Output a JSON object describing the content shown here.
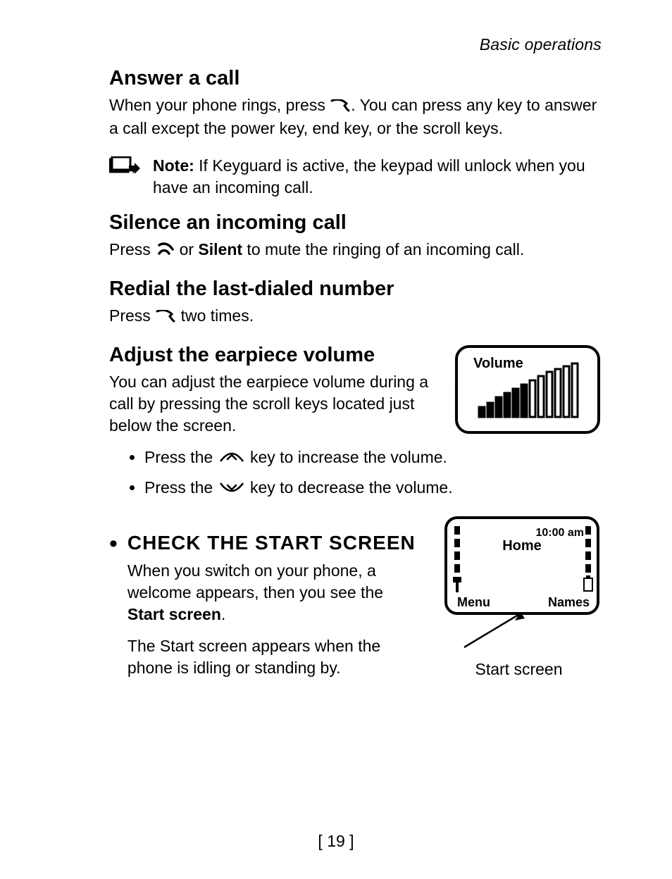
{
  "header": "Basic operations",
  "sections": {
    "answer": {
      "title": "Answer a call",
      "p1a": "When your phone rings, press ",
      "p1b": ". You can press any key to answer a call except the power key, end key, or the scroll keys.",
      "note_label": "Note:",
      "note_text": " If Keyguard is active, the keypad will unlock when you have an incoming call."
    },
    "silence": {
      "title": "Silence an incoming call",
      "p_a": "Press ",
      "p_b": " or ",
      "silent": "Silent",
      "p_c": " to mute the ringing of an incoming call."
    },
    "redial": {
      "title": "Redial the last-dialed number",
      "p_a": "Press ",
      "p_b": " two times."
    },
    "volume": {
      "title": "Adjust the earpiece volume",
      "p": "You can adjust the earpiece volume during a call by pressing the scroll keys located just below the screen.",
      "b1a": "Press the ",
      "b1b": " key to increase the volume.",
      "b2a": "Press the ",
      "b2b": " key to decrease the volume.",
      "screen_label": "Volume"
    },
    "start": {
      "title": "CHECK THE START SCREEN",
      "p1a": "When you switch on your phone, a welcome appears, then you see the ",
      "p1b": "Start screen",
      "p1c": ".",
      "p2": "The Start screen appears when the phone is idling or standing by.",
      "caption": "Start screen",
      "screen": {
        "time": "10:00 am",
        "title": "Home",
        "softkey_left": "Menu",
        "softkey_right": "Names"
      }
    }
  },
  "page_number": "[ 19 ]"
}
